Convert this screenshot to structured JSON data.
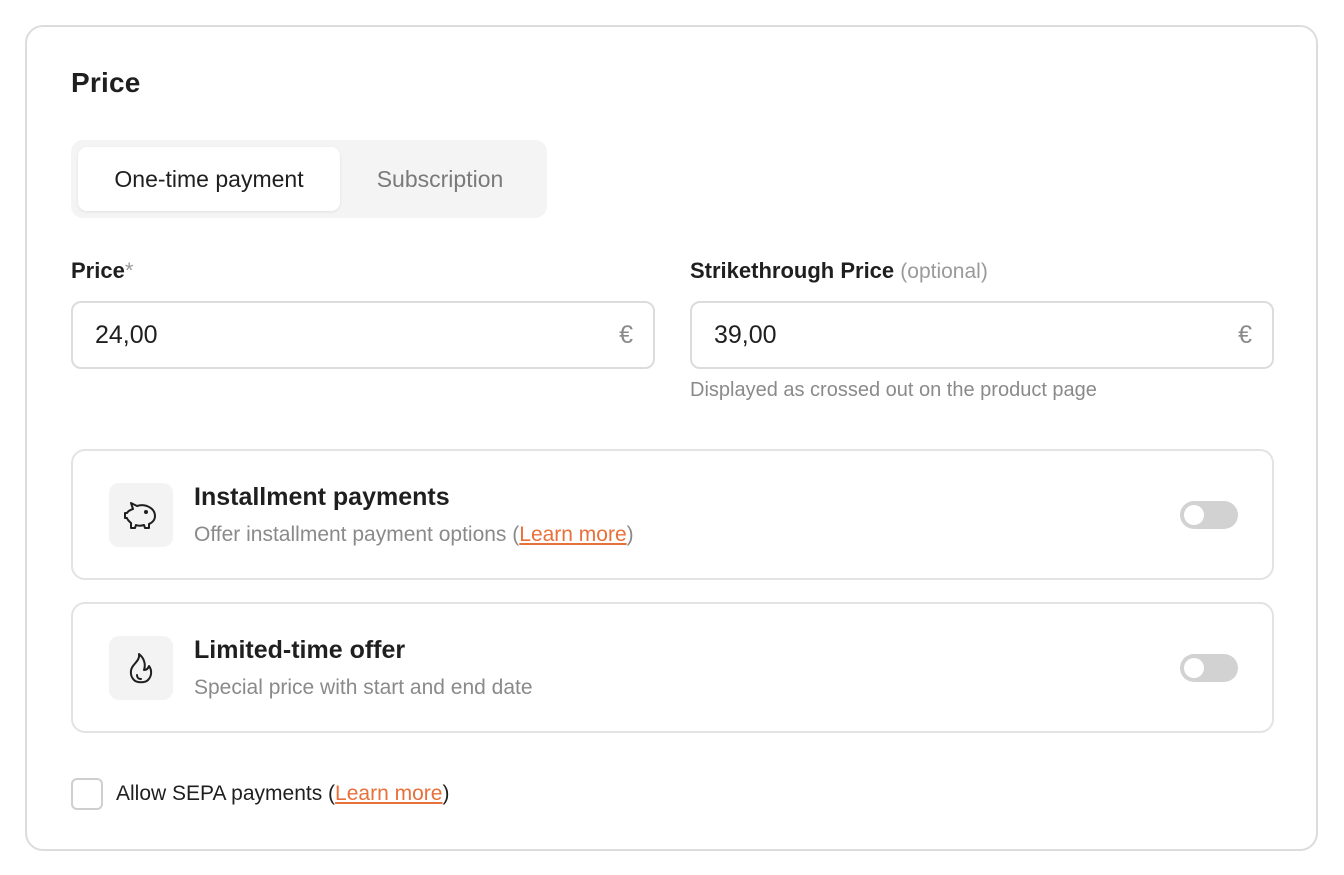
{
  "section": {
    "title": "Price"
  },
  "pricing_type": {
    "options": [
      "One-time payment",
      "Subscription"
    ],
    "selected": "One-time payment"
  },
  "price_field": {
    "label": "Price",
    "required_mark": "*",
    "value": "24,00",
    "currency": "€"
  },
  "strike_field": {
    "label": "Strikethrough Price",
    "optional_text": "(optional)",
    "value": "39,00",
    "currency": "€",
    "help": "Displayed as crossed out on the product page"
  },
  "installments": {
    "icon": "piggy-bank-icon",
    "title": "Installment payments",
    "desc_prefix": "Offer installment payment options (",
    "link": "Learn more",
    "desc_suffix": ")",
    "enabled": false
  },
  "limited_offer": {
    "icon": "flame-icon",
    "title": "Limited-time offer",
    "desc": "Special price with start and end date",
    "enabled": false
  },
  "sepa": {
    "label_prefix": "Allow SEPA payments (",
    "link": "Learn more",
    "label_suffix": ")",
    "checked": false
  },
  "colors": {
    "accent_link": "#e8703a",
    "toggle_off": "#d2d2d2",
    "border": "#dcdcdc"
  }
}
